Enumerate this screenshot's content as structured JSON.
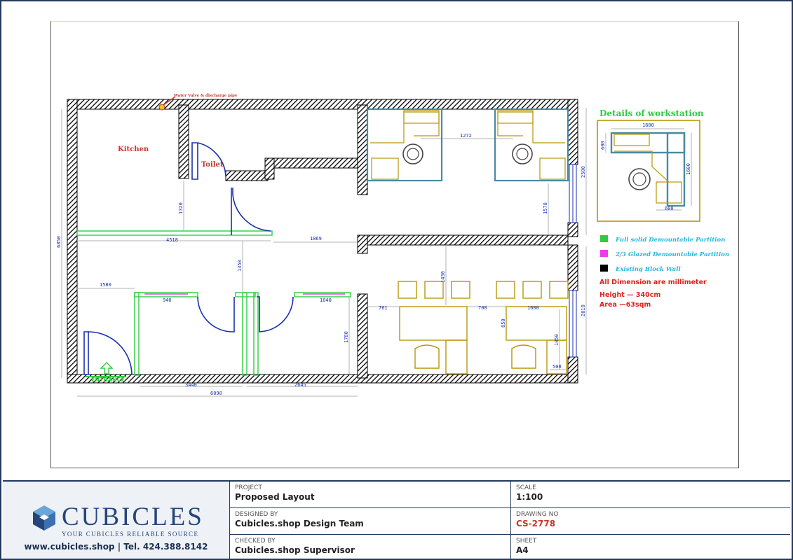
{
  "plan": {
    "annotations": {
      "water_valve": "Water Valve & discharge pipe",
      "kitchen": "Kitchen",
      "toilet": "Toilet",
      "entrance": "ENTRANCE"
    },
    "dimensions": {
      "d_1272": "1272",
      "d_1320": "1320",
      "d_4518": "4518",
      "d_1869": "1869",
      "d_6850": "6850",
      "d_1578": "1578",
      "d_2500": "2500",
      "d_1580": "1580",
      "d_1350": "1350",
      "d_1430": "1430",
      "d_940": "940",
      "d_1040": "1040",
      "d_761": "761",
      "d_700": "700",
      "d_1600": "1600",
      "d_850": "850",
      "d_1780": "1780",
      "d_1050": "1050",
      "d_500": "500",
      "d_2010": "2010",
      "d_3440": "3440",
      "d_2645": "2645",
      "d_6090": "6090",
      "ws_1600": "1600",
      "ws_600a": "600",
      "ws_1600v": "1600",
      "ws_600b": "600"
    },
    "detail": {
      "title": "Details of workstation"
    },
    "legend": {
      "items": [
        {
          "label": "Full solid Demountable Partition",
          "color": "#2ecc40"
        },
        {
          "label": "2/3 Glazed Demountable Partition",
          "color": "#e83ee8"
        },
        {
          "label": "Existing Block Wall",
          "color": "#000000"
        }
      ],
      "note1": "All Dimension are millimeter",
      "note2": "Height  —  340cm",
      "note3": "Area   —63sqm"
    },
    "colors": {
      "dimension": "#1a2fb0",
      "partition": "#2ecc40",
      "glazed": "#e83ee8",
      "furniture": "#b8960c",
      "desk_frame": "#4a8aa0"
    }
  },
  "title_block": {
    "logo_name": "CUBICLES",
    "tagline": "YOUR CUBICLES RELIABLE SOURCE",
    "contact": "www.cubicles.shop   |   Tel. 424.388.8142",
    "project_label": "PROJECT",
    "project_value": "Proposed Layout",
    "designed_label": "DESIGNED BY",
    "designed_value": "Cubicles.shop Design Team",
    "checked_label": "CHECKED BY",
    "checked_value": "Cubicles.shop Supervisor",
    "scale_label": "SCALE",
    "scale_value": "1:100",
    "drawing_label": "DRAWING NO",
    "drawing_value": "CS-2778",
    "sheet_label": "SHEET",
    "sheet_value": "A4"
  }
}
